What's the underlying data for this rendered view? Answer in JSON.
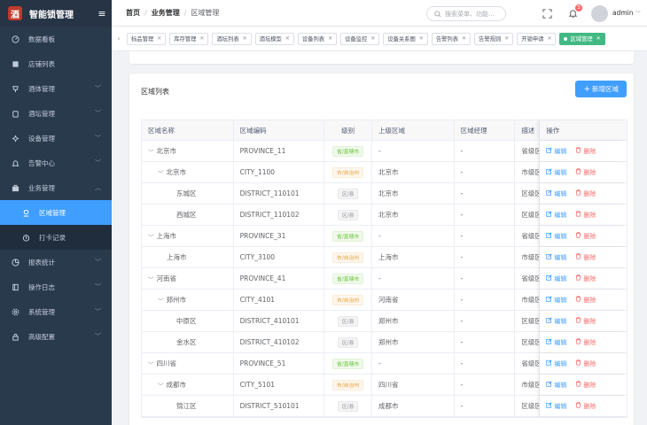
{
  "app": {
    "logo_char": "酒",
    "title": "智能锁管理"
  },
  "sidebar": {
    "items": [
      {
        "label": "数据看板",
        "icon": "dashboard-icon"
      },
      {
        "label": "店铺列表",
        "icon": "shop-icon"
      },
      {
        "label": "酒体管理",
        "icon": "wine-icon",
        "chevron": "down"
      },
      {
        "label": "酒坛管理",
        "icon": "jar-icon",
        "chevron": "down"
      },
      {
        "label": "设备管理",
        "icon": "device-icon",
        "chevron": "down"
      },
      {
        "label": "告警中心",
        "icon": "bell-icon",
        "chevron": "down"
      },
      {
        "label": "业务管理",
        "icon": "briefcase-icon",
        "chevron": "up",
        "children": [
          {
            "label": "区域管理",
            "icon": "location-icon",
            "active": true
          },
          {
            "label": "打卡记录",
            "icon": "clock-icon"
          }
        ]
      },
      {
        "label": "报表统计",
        "icon": "chart-icon",
        "chevron": "down"
      },
      {
        "label": "操作日志",
        "icon": "log-icon",
        "chevron": "down"
      },
      {
        "label": "系统管理",
        "icon": "settings-icon",
        "chevron": "down"
      },
      {
        "label": "高级配置",
        "icon": "lock-icon",
        "chevron": "down"
      }
    ]
  },
  "header": {
    "breadcrumb": [
      "首页",
      "业务管理",
      "区域管理"
    ],
    "search_placeholder": "搜索菜单、功能...",
    "notification_count": "3",
    "username": "admin"
  },
  "tags": [
    {
      "label": "标品管理"
    },
    {
      "label": "库存管理"
    },
    {
      "label": "酒坛列表"
    },
    {
      "label": "酒坛模型"
    },
    {
      "label": "设备列表"
    },
    {
      "label": "设备监控"
    },
    {
      "label": "设备关系图"
    },
    {
      "label": "告警列表"
    },
    {
      "label": "告警规则"
    },
    {
      "label": "开锁申请"
    },
    {
      "label": "区域管理",
      "active": true
    }
  ],
  "card": {
    "title": "区域列表",
    "add_button": "新增区域"
  },
  "table": {
    "columns": [
      "区域名称",
      "区域编码",
      "级别",
      "上级区域",
      "区域经理",
      "描述",
      "操作"
    ],
    "edit_label": "编辑",
    "delete_label": "删除",
    "rows": [
      {
        "name": "北京市",
        "depth": 0,
        "expand": true,
        "code": "PROVINCE_11",
        "level": "省/直辖市",
        "ltype": "p",
        "parent": "-",
        "manager": "-",
        "desc": "省级区域"
      },
      {
        "name": "北京市",
        "depth": 1,
        "expand": true,
        "code": "CITY_1100",
        "level": "市/自治州",
        "ltype": "c",
        "parent": "北京市",
        "manager": "-",
        "desc": "市级区域"
      },
      {
        "name": "东城区",
        "depth": 2,
        "expand": false,
        "code": "DISTRICT_110101",
        "level": "区/县",
        "ltype": "d",
        "parent": "北京市",
        "manager": "-",
        "desc": "区级区域"
      },
      {
        "name": "西城区",
        "depth": 2,
        "expand": false,
        "code": "DISTRICT_110102",
        "level": "区/县",
        "ltype": "d",
        "parent": "北京市",
        "manager": "-",
        "desc": "区级区域"
      },
      {
        "name": "上海市",
        "depth": 0,
        "expand": true,
        "code": "PROVINCE_31",
        "level": "省/直辖市",
        "ltype": "p",
        "parent": "-",
        "manager": "-",
        "desc": "省级区域"
      },
      {
        "name": "上海市",
        "depth": 1,
        "expand": false,
        "code": "CITY_3100",
        "level": "市/自治州",
        "ltype": "c",
        "parent": "上海市",
        "manager": "-",
        "desc": "市级区域"
      },
      {
        "name": "河南省",
        "depth": 0,
        "expand": true,
        "code": "PROVINCE_41",
        "level": "省/直辖市",
        "ltype": "p",
        "parent": "-",
        "manager": "-",
        "desc": "省级区域"
      },
      {
        "name": "郑州市",
        "depth": 1,
        "expand": true,
        "code": "CITY_4101",
        "level": "市/自治州",
        "ltype": "c",
        "parent": "河南省",
        "manager": "-",
        "desc": "市级区域"
      },
      {
        "name": "中原区",
        "depth": 2,
        "expand": false,
        "code": "DISTRICT_410101",
        "level": "区/县",
        "ltype": "d",
        "parent": "郑州市",
        "manager": "-",
        "desc": "区级区域"
      },
      {
        "name": "金水区",
        "depth": 2,
        "expand": false,
        "code": "DISTRICT_410102",
        "level": "区/县",
        "ltype": "d",
        "parent": "郑州市",
        "manager": "-",
        "desc": "区级区域"
      },
      {
        "name": "四川省",
        "depth": 0,
        "expand": true,
        "code": "PROVINCE_51",
        "level": "省/直辖市",
        "ltype": "p",
        "parent": "-",
        "manager": "-",
        "desc": "省级区域"
      },
      {
        "name": "成都市",
        "depth": 1,
        "expand": true,
        "code": "CITY_5101",
        "level": "市/自治州",
        "ltype": "c",
        "parent": "四川省",
        "manager": "-",
        "desc": "市级区域"
      },
      {
        "name": "锦江区",
        "depth": 2,
        "expand": false,
        "code": "DISTRICT_510101",
        "level": "区/县",
        "ltype": "d",
        "parent": "成都市",
        "manager": "-",
        "desc": "区级区域"
      }
    ]
  },
  "colors": {
    "sidebar_bg": "#2a3a4d",
    "primary": "#409eff",
    "active_tag": "#42b983",
    "danger": "#f56c6c"
  }
}
